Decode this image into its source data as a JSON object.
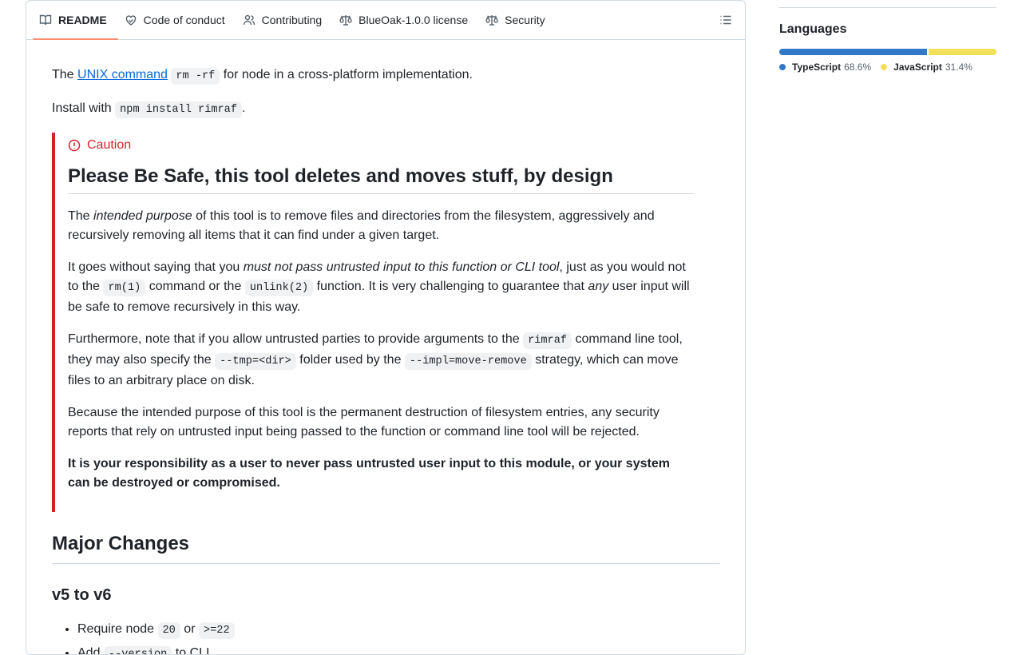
{
  "tabs": [
    {
      "label": "README",
      "icon": "book-icon",
      "active": true
    },
    {
      "label": "Code of conduct",
      "icon": "heart-icon",
      "active": false
    },
    {
      "label": "Contributing",
      "icon": "people-icon",
      "active": false
    },
    {
      "label": "BlueOak-1.0.0 license",
      "icon": "law-icon",
      "active": false
    },
    {
      "label": "Security",
      "icon": "law-icon",
      "active": false
    }
  ],
  "intro": {
    "prefix": "The ",
    "link": "UNIX command",
    "code": "rm -rf",
    "suffix": " for node in a cross-platform implementation."
  },
  "install": {
    "prefix": "Install with ",
    "code": "npm install rimraf",
    "suffix": "."
  },
  "caution": {
    "title": "Caution",
    "heading": "Please Be Safe, this tool deletes and moves stuff, by design",
    "p1": {
      "a": "The ",
      "em": "intended purpose",
      "b": " of this tool is to remove files and directories from the filesystem, aggressively and recursively removing all items that it can find under a given target."
    },
    "p2": {
      "a": "It goes without saying that you ",
      "em": "must not pass untrusted input to this function or CLI tool",
      "b": ", just as you would not to the ",
      "code1": "rm(1)",
      "c": " command or the ",
      "code2": "unlink(2)",
      "d": " function. It is very challenging to guarantee that ",
      "em2": "any",
      "e": " user input will be safe to remove recursively in this way."
    },
    "p3": {
      "a": "Furthermore, note that if you allow untrusted parties to provide arguments to the ",
      "code1": "rimraf",
      "b": " command line tool, they may also specify the ",
      "code2": "--tmp=<dir>",
      "c": " folder used by the ",
      "code3": "--impl=move-remove",
      "d": " strategy, which can move files to an arbitrary place on disk."
    },
    "p4": "Because the intended purpose of this tool is the permanent destruction of filesystem entries, any security reports that rely on untrusted input being passed to the function or command line tool will be rejected.",
    "p5": "It is your responsibility as a user to never pass untrusted user input to this module, or your system can be destroyed or compromised."
  },
  "major_heading": "Major Changes",
  "v5_heading": "v5 to v6",
  "changes": [
    {
      "a": "Require node ",
      "code1": "20",
      "b": " or ",
      "code2": ">=22"
    },
    {
      "a": "Add ",
      "code1": "--version",
      "b": " to CLI"
    }
  ],
  "sidebar": {
    "title": "Languages",
    "languages": [
      {
        "name": "TypeScript",
        "percent": "68.6%",
        "value": 68.6,
        "color": "#3178c6"
      },
      {
        "name": "JavaScript",
        "percent": "31.4%",
        "value": 31.4,
        "color": "#f1e05a"
      }
    ]
  }
}
